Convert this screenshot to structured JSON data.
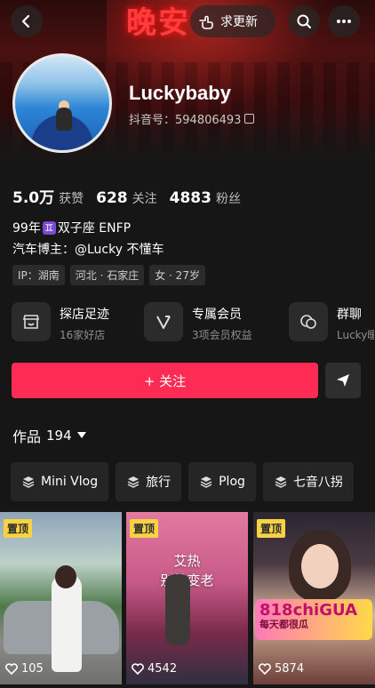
{
  "header": {
    "neon_text": "晚安",
    "update_label": "求更新",
    "icons": {
      "back": "back-arrow-icon",
      "update": "hand-point-icon",
      "search": "search-icon",
      "more": "more-dots-icon"
    }
  },
  "profile": {
    "name": "Luckybaby",
    "douyin_id_label": "抖音号：594806493"
  },
  "stats": [
    {
      "value": "5.0万",
      "label": "获赞"
    },
    {
      "value": "628",
      "label": "关注"
    },
    {
      "value": "4883",
      "label": "粉丝"
    }
  ],
  "bio": {
    "line1_prefix": "99年",
    "line1_gem": "♊",
    "line1_suffix": "双子座 ENFP",
    "line2": "汽车博主：@Lucky 不懂车"
  },
  "tags": [
    "IP：湖南",
    "河北 · 石家庄",
    "女 · 27岁"
  ],
  "services": [
    {
      "title": "探店足迹",
      "subtitle": "16家好店",
      "icon": "store-icon"
    },
    {
      "title": "专属会员",
      "subtitle": "3项会员权益",
      "icon": "v-membership-icon"
    },
    {
      "title": "群聊",
      "subtitle": "Lucky暖",
      "icon": "group-chat-icon"
    }
  ],
  "actions": {
    "follow_label": "+ 关注",
    "share_icon": "send-icon"
  },
  "works": {
    "label": "作品",
    "count": "194"
  },
  "filters": [
    {
      "label": "Mini Vlog",
      "icon": "layers-icon"
    },
    {
      "label": "旅行",
      "icon": "layers-icon"
    },
    {
      "label": "Plog",
      "icon": "layers-icon"
    },
    {
      "label": "七音八拐",
      "icon": "layers-icon"
    }
  ],
  "videos": [
    {
      "pinned": "置顶",
      "likes": "105"
    },
    {
      "pinned": "置顶",
      "likes": "4542",
      "overlay_line1": "艾热",
      "overlay_line2": "别怕变老"
    },
    {
      "pinned": "置顶",
      "likes": "5874",
      "promo_title": "818chiGUA",
      "promo_sub": "每天都很瓜"
    }
  ],
  "colors": {
    "accent": "#fe2c55",
    "pin": "#f7d244",
    "background": "#161616"
  }
}
